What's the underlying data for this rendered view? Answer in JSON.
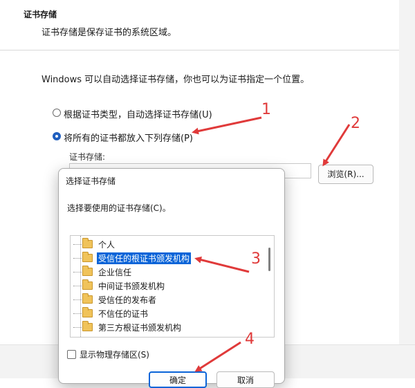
{
  "header": {
    "title": "证书存储",
    "subtitle": "证书存储是保存证书的系统区域。"
  },
  "intro": "Windows 可以自动选择证书存储，你也可以为证书指定一个位置。",
  "options": {
    "auto_label": "根据证书类型，自动选择证书存储(U)",
    "manual_label": "将所有的证书都放入下列存储(P)",
    "selected": "manual"
  },
  "store_label": "证书存储:",
  "browse_label": "浏览(R)...",
  "dialog": {
    "title": "选择证书存储",
    "prompt": "选择要使用的证书存储(C)。",
    "stores": [
      "个人",
      "受信任的根证书颁发机构",
      "企业信任",
      "中间证书颁发机构",
      "受信任的发布者",
      "不信任的证书",
      "第三方根证书颁发机构"
    ],
    "selected_index": 1,
    "show_physical_label": "显示物理存储区(S)",
    "ok_label": "确定",
    "cancel_label": "取消"
  },
  "annotations": [
    "1",
    "2",
    "3",
    "4"
  ],
  "colors": {
    "accent": "#0a64d8",
    "annotation": "#e03a3a",
    "folder": "#f0c35a"
  },
  "icons": {
    "tree_item": "folder-icon"
  }
}
